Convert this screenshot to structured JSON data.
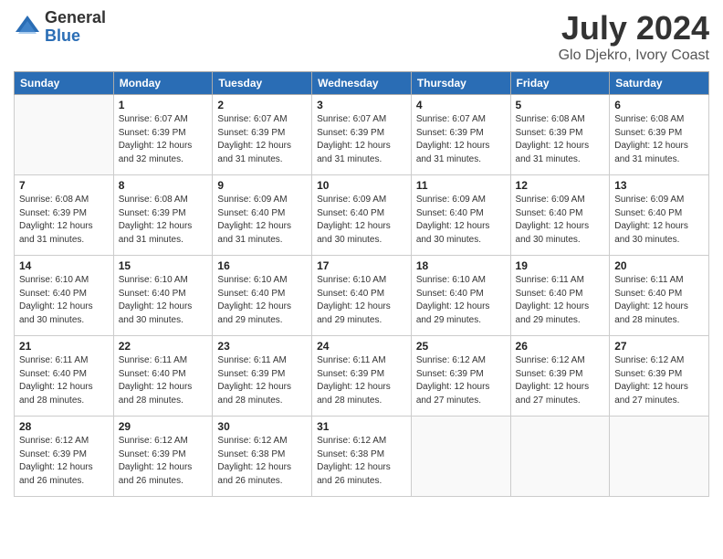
{
  "logo": {
    "general": "General",
    "blue": "Blue"
  },
  "title": "July 2024",
  "subtitle": "Glo Djekro, Ivory Coast",
  "weekdays": [
    "Sunday",
    "Monday",
    "Tuesday",
    "Wednesday",
    "Thursday",
    "Friday",
    "Saturday"
  ],
  "weeks": [
    [
      {
        "day": "",
        "info": ""
      },
      {
        "day": "1",
        "info": "Sunrise: 6:07 AM\nSunset: 6:39 PM\nDaylight: 12 hours\nand 32 minutes."
      },
      {
        "day": "2",
        "info": "Sunrise: 6:07 AM\nSunset: 6:39 PM\nDaylight: 12 hours\nand 31 minutes."
      },
      {
        "day": "3",
        "info": "Sunrise: 6:07 AM\nSunset: 6:39 PM\nDaylight: 12 hours\nand 31 minutes."
      },
      {
        "day": "4",
        "info": "Sunrise: 6:07 AM\nSunset: 6:39 PM\nDaylight: 12 hours\nand 31 minutes."
      },
      {
        "day": "5",
        "info": "Sunrise: 6:08 AM\nSunset: 6:39 PM\nDaylight: 12 hours\nand 31 minutes."
      },
      {
        "day": "6",
        "info": "Sunrise: 6:08 AM\nSunset: 6:39 PM\nDaylight: 12 hours\nand 31 minutes."
      }
    ],
    [
      {
        "day": "7",
        "info": "Sunrise: 6:08 AM\nSunset: 6:39 PM\nDaylight: 12 hours\nand 31 minutes."
      },
      {
        "day": "8",
        "info": "Sunrise: 6:08 AM\nSunset: 6:39 PM\nDaylight: 12 hours\nand 31 minutes."
      },
      {
        "day": "9",
        "info": "Sunrise: 6:09 AM\nSunset: 6:40 PM\nDaylight: 12 hours\nand 31 minutes."
      },
      {
        "day": "10",
        "info": "Sunrise: 6:09 AM\nSunset: 6:40 PM\nDaylight: 12 hours\nand 30 minutes."
      },
      {
        "day": "11",
        "info": "Sunrise: 6:09 AM\nSunset: 6:40 PM\nDaylight: 12 hours\nand 30 minutes."
      },
      {
        "day": "12",
        "info": "Sunrise: 6:09 AM\nSunset: 6:40 PM\nDaylight: 12 hours\nand 30 minutes."
      },
      {
        "day": "13",
        "info": "Sunrise: 6:09 AM\nSunset: 6:40 PM\nDaylight: 12 hours\nand 30 minutes."
      }
    ],
    [
      {
        "day": "14",
        "info": "Sunrise: 6:10 AM\nSunset: 6:40 PM\nDaylight: 12 hours\nand 30 minutes."
      },
      {
        "day": "15",
        "info": "Sunrise: 6:10 AM\nSunset: 6:40 PM\nDaylight: 12 hours\nand 30 minutes."
      },
      {
        "day": "16",
        "info": "Sunrise: 6:10 AM\nSunset: 6:40 PM\nDaylight: 12 hours\nand 29 minutes."
      },
      {
        "day": "17",
        "info": "Sunrise: 6:10 AM\nSunset: 6:40 PM\nDaylight: 12 hours\nand 29 minutes."
      },
      {
        "day": "18",
        "info": "Sunrise: 6:10 AM\nSunset: 6:40 PM\nDaylight: 12 hours\nand 29 minutes."
      },
      {
        "day": "19",
        "info": "Sunrise: 6:11 AM\nSunset: 6:40 PM\nDaylight: 12 hours\nand 29 minutes."
      },
      {
        "day": "20",
        "info": "Sunrise: 6:11 AM\nSunset: 6:40 PM\nDaylight: 12 hours\nand 28 minutes."
      }
    ],
    [
      {
        "day": "21",
        "info": "Sunrise: 6:11 AM\nSunset: 6:40 PM\nDaylight: 12 hours\nand 28 minutes."
      },
      {
        "day": "22",
        "info": "Sunrise: 6:11 AM\nSunset: 6:40 PM\nDaylight: 12 hours\nand 28 minutes."
      },
      {
        "day": "23",
        "info": "Sunrise: 6:11 AM\nSunset: 6:39 PM\nDaylight: 12 hours\nand 28 minutes."
      },
      {
        "day": "24",
        "info": "Sunrise: 6:11 AM\nSunset: 6:39 PM\nDaylight: 12 hours\nand 28 minutes."
      },
      {
        "day": "25",
        "info": "Sunrise: 6:12 AM\nSunset: 6:39 PM\nDaylight: 12 hours\nand 27 minutes."
      },
      {
        "day": "26",
        "info": "Sunrise: 6:12 AM\nSunset: 6:39 PM\nDaylight: 12 hours\nand 27 minutes."
      },
      {
        "day": "27",
        "info": "Sunrise: 6:12 AM\nSunset: 6:39 PM\nDaylight: 12 hours\nand 27 minutes."
      }
    ],
    [
      {
        "day": "28",
        "info": "Sunrise: 6:12 AM\nSunset: 6:39 PM\nDaylight: 12 hours\nand 26 minutes."
      },
      {
        "day": "29",
        "info": "Sunrise: 6:12 AM\nSunset: 6:39 PM\nDaylight: 12 hours\nand 26 minutes."
      },
      {
        "day": "30",
        "info": "Sunrise: 6:12 AM\nSunset: 6:38 PM\nDaylight: 12 hours\nand 26 minutes."
      },
      {
        "day": "31",
        "info": "Sunrise: 6:12 AM\nSunset: 6:38 PM\nDaylight: 12 hours\nand 26 minutes."
      },
      {
        "day": "",
        "info": ""
      },
      {
        "day": "",
        "info": ""
      },
      {
        "day": "",
        "info": ""
      }
    ]
  ]
}
